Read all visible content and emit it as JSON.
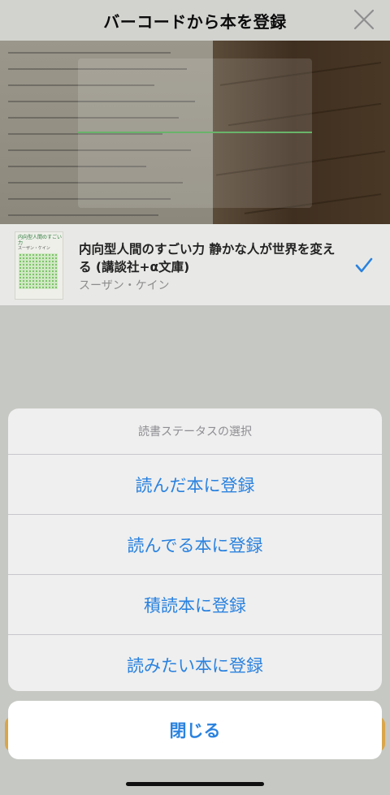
{
  "header": {
    "title": "バーコードから本を登録",
    "close_icon": "close-icon"
  },
  "book": {
    "title": "内向型人間のすごい力 静かな人が世界を変える (講談社+α文庫)",
    "author": "スーザン・ケイン",
    "cover_title": "内向型人間のすごい力",
    "cover_author": "スーザン・ケイン",
    "selected_icon": "checkmark-icon"
  },
  "action_sheet": {
    "title": "読書ステータスの選択",
    "options": [
      "読んだ本に登録",
      "読んでる本に登録",
      "積読本に登録",
      "読みたい本に登録"
    ],
    "cancel_label": "閉じる"
  },
  "colors": {
    "accent": "#2a82df",
    "scan_line": "#69b46a"
  }
}
